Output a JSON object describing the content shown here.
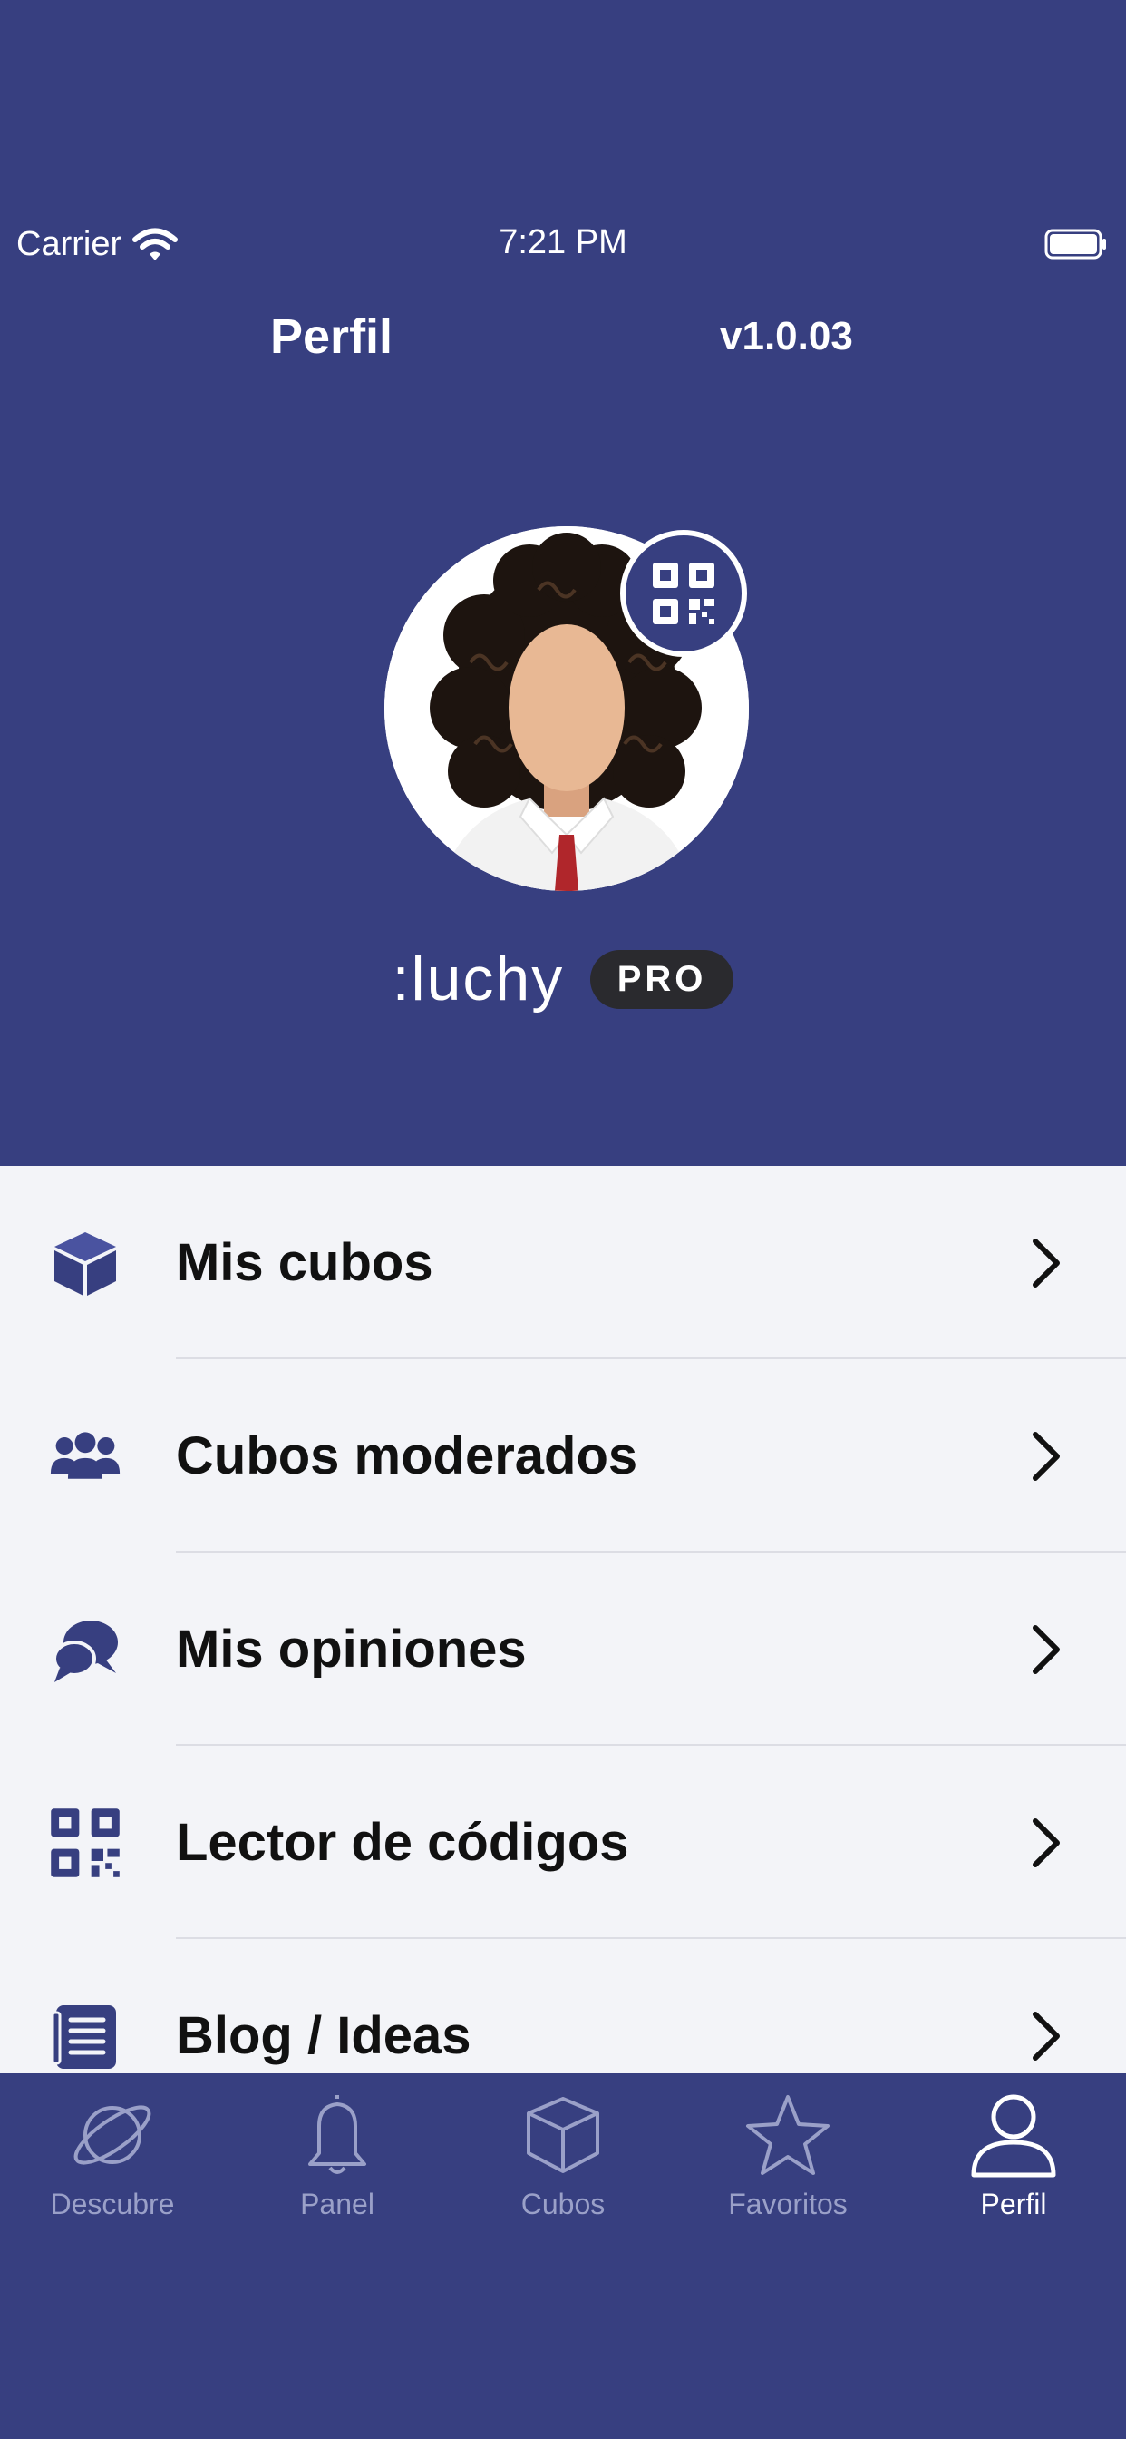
{
  "status": {
    "carrier": "Carrier",
    "time": "7:21 PM"
  },
  "header": {
    "title": "Perfil",
    "version": "v1.0.03"
  },
  "profile": {
    "username": ":luchy",
    "badge": "PRO"
  },
  "menu": [
    {
      "label": "Mis cubos",
      "icon": "cube-icon"
    },
    {
      "label": "Cubos moderados",
      "icon": "group-icon"
    },
    {
      "label": "Mis opiniones",
      "icon": "chat-bubbles-icon"
    },
    {
      "label": "Lector de códigos",
      "icon": "qr-code-icon"
    },
    {
      "label": "Blog / Ideas",
      "icon": "blog-icon"
    }
  ],
  "tabs": [
    {
      "label": "Descubre",
      "icon": "planet-icon"
    },
    {
      "label": "Panel",
      "icon": "bell-icon"
    },
    {
      "label": "Cubos",
      "icon": "cube-outline-icon"
    },
    {
      "label": "Favoritos",
      "icon": "star-icon"
    },
    {
      "label": "Perfil",
      "icon": "user-icon",
      "active": true
    }
  ],
  "colors": {
    "primary": "#373F80",
    "menu_bg": "#F3F4F8",
    "tab_inactive": "#9AA0C8"
  }
}
